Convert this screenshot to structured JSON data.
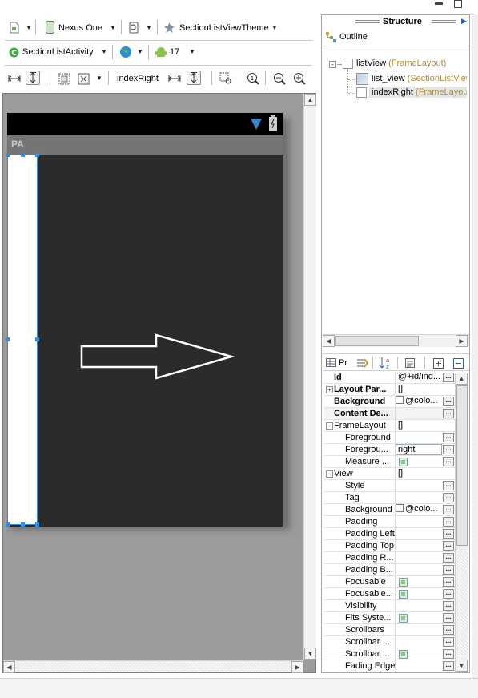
{
  "toolbar1": {
    "device": "Nexus One",
    "theme": "SectionListViewTheme"
  },
  "toolbar2": {
    "activity": "SectionListActivity",
    "api": "17"
  },
  "toolbar3": {
    "selection": "indexRight"
  },
  "device_screen": {
    "pa_label": "PA"
  },
  "structure": {
    "title": "Structure",
    "outline_tab": "Outline",
    "tree": [
      {
        "name": "listView",
        "type": "(FrameLayout)"
      },
      {
        "name": "list_view",
        "type": "(SectionListView"
      },
      {
        "name": "indexRight",
        "type": "(FrameLayou"
      }
    ]
  },
  "properties": {
    "tab_label": "Pr",
    "rows": [
      {
        "name": "Id",
        "value": "@+id/ind...",
        "bold": true
      },
      {
        "name": "Layout Par...",
        "value": "[]",
        "bold": true
      },
      {
        "name": "Background",
        "value": "@colo...",
        "bold": true
      },
      {
        "name": "Content De...",
        "value": "",
        "bold": true
      },
      {
        "name": "FrameLayout",
        "value": "[]"
      },
      {
        "name": "Foreground",
        "value": ""
      },
      {
        "name": "Foregrou...",
        "value": "right"
      },
      {
        "name": "Measure ...",
        "value": ""
      },
      {
        "name": "View",
        "value": "[]"
      },
      {
        "name": "Style",
        "value": ""
      },
      {
        "name": "Tag",
        "value": ""
      },
      {
        "name": "Background",
        "value": "@colo..."
      },
      {
        "name": "Padding",
        "value": ""
      },
      {
        "name": "Padding Left",
        "value": ""
      },
      {
        "name": "Padding Top",
        "value": ""
      },
      {
        "name": "Padding R...",
        "value": ""
      },
      {
        "name": "Padding B...",
        "value": ""
      },
      {
        "name": "Focusable",
        "value": ""
      },
      {
        "name": "Focusable...",
        "value": ""
      },
      {
        "name": "Visibility",
        "value": ""
      },
      {
        "name": "Fits Syste...",
        "value": ""
      },
      {
        "name": "Scrollbars",
        "value": ""
      },
      {
        "name": "Scrollbar ...",
        "value": ""
      },
      {
        "name": "Scrollbar ...",
        "value": ""
      },
      {
        "name": "Fading Edge",
        "value": ""
      }
    ]
  },
  "colors": {
    "canvas_bg": "#9b9b9b",
    "device_body": "#2a2a2a",
    "selection_handle": "#2e8de6"
  }
}
